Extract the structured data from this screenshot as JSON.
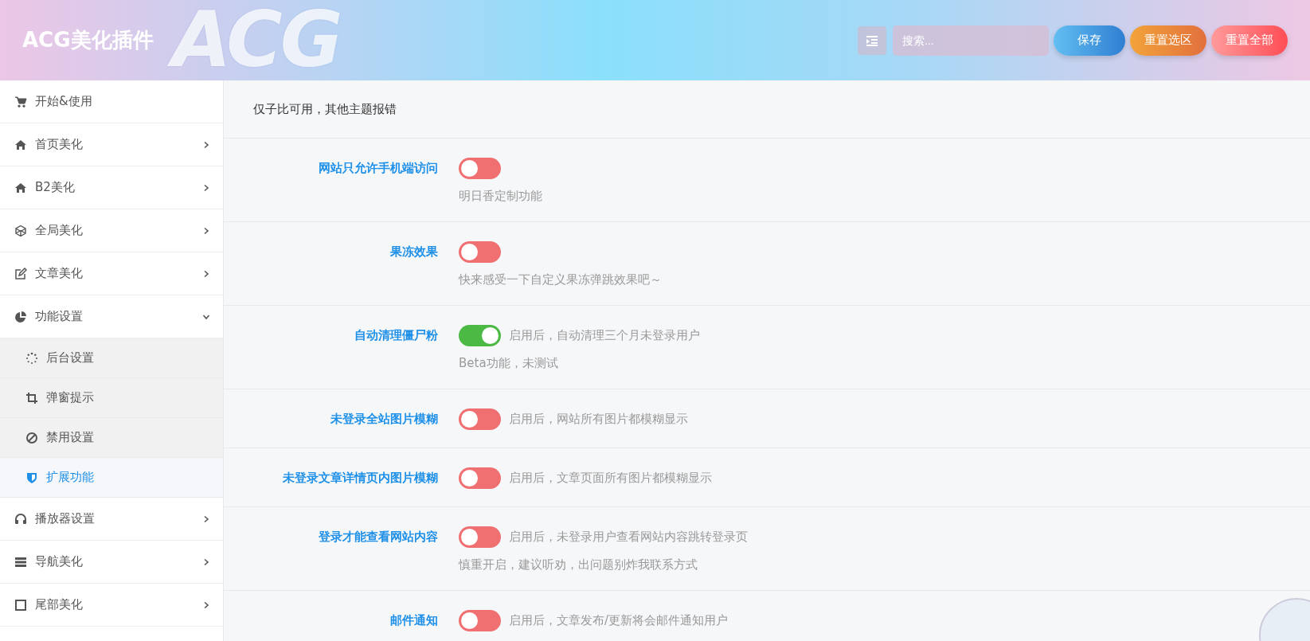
{
  "header": {
    "title": "ACG美化插件",
    "backdrop_text": "ACG",
    "search": {
      "placeholder": "搜索..."
    },
    "buttons": [
      {
        "label": "保存",
        "kind": "save"
      },
      {
        "label": "重置选区",
        "kind": "reset-section"
      },
      {
        "label": "重置全部",
        "kind": "reset-all"
      }
    ]
  },
  "sidebar": {
    "items": [
      {
        "label": "开始&使用",
        "kind": "cart",
        "selected": false
      },
      {
        "label": "首页美化",
        "kind": "home",
        "expanded": false,
        "selected": false
      },
      {
        "label": "B2美化",
        "kind": "home",
        "expanded": false,
        "selected": false
      },
      {
        "label": "全局美化",
        "kind": "cube",
        "expanded": false,
        "selected": false
      },
      {
        "label": "文章美化",
        "kind": "edit",
        "expanded": false,
        "selected": false
      },
      {
        "label": "功能设置",
        "kind": "pie",
        "expanded": true,
        "selected": false,
        "children": [
          {
            "label": "后台设置",
            "kind": "spinner",
            "selected": false
          },
          {
            "label": "弹窗提示",
            "kind": "crop",
            "selected": false
          },
          {
            "label": "禁用设置",
            "kind": "ban",
            "selected": false
          },
          {
            "label": "扩展功能",
            "kind": "shield",
            "selected": true
          }
        ]
      },
      {
        "label": "播放器设置",
        "kind": "headphones",
        "expanded": false,
        "selected": false
      },
      {
        "label": "导航美化",
        "kind": "bars",
        "expanded": false,
        "selected": false
      },
      {
        "label": "尾部美化",
        "kind": "frame",
        "expanded": false,
        "selected": false
      }
    ]
  },
  "content": {
    "notice": "仅子比可用，其他主题报错",
    "settings": [
      {
        "label": "网站只允许手机端访问",
        "on": false,
        "description": "明日香定制功能"
      },
      {
        "label": "果冻效果",
        "on": false,
        "description": "快来感受一下自定义果冻弹跳效果吧～"
      },
      {
        "label": "自动清理僵尸粉",
        "on": true,
        "inline_hint": "启用后，自动清理三个月未登录用户",
        "description": "Beta功能，未测试"
      },
      {
        "label": "未登录全站图片模糊",
        "on": false,
        "inline_hint": "启用后，网站所有图片都模糊显示"
      },
      {
        "label": "未登录文章详情页内图片模糊",
        "on": false,
        "inline_hint": "启用后，文章页面所有图片都模糊显示"
      },
      {
        "label": "登录才能查看网站内容",
        "on": false,
        "inline_hint": "启用后，未登录用户查看网站内容跳转登录页",
        "description": "慎重开启，建议听劝，出问题别炸我联系方式"
      },
      {
        "label": "邮件通知",
        "on": false,
        "inline_hint": "启用后，文章发布/更新将会邮件通知用户"
      }
    ]
  }
}
